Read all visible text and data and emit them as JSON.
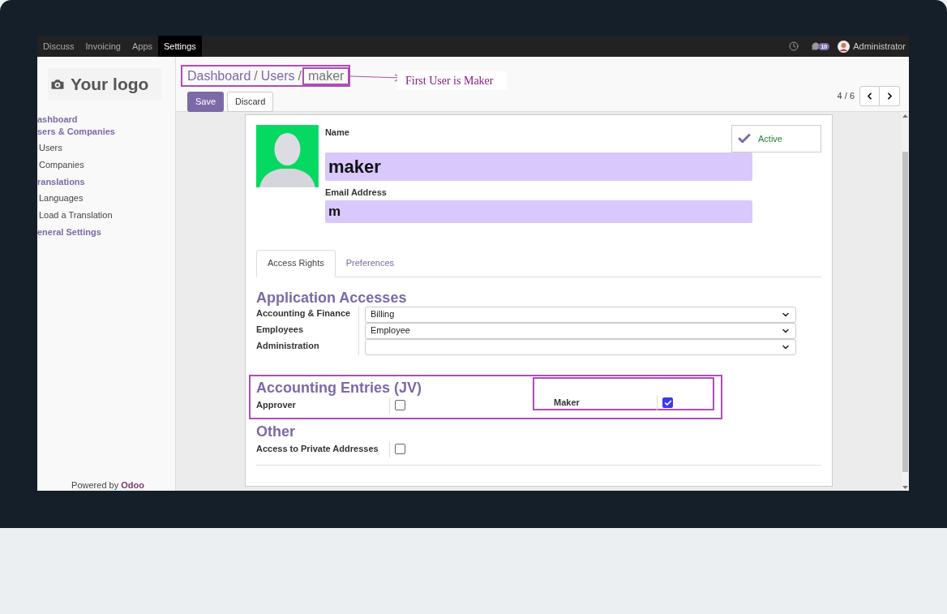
{
  "top_menu": [
    {
      "label": "Discuss",
      "selected": false
    },
    {
      "label": "Invoicing",
      "selected": false
    },
    {
      "label": "Apps",
      "selected": false
    },
    {
      "label": "Settings",
      "selected": true
    }
  ],
  "systray": {
    "messages_count": "10",
    "user": "Administrator"
  },
  "sidebar": {
    "logo_text": "Your logo",
    "items": [
      {
        "label": "ashboard"
      },
      {
        "label": "sers & Companies",
        "children": [
          {
            "label": "Users"
          },
          {
            "label": "Companies"
          }
        ]
      },
      {
        "label": "ranslations",
        "children": [
          {
            "label": "Languages"
          },
          {
            "label": "Load a Translation"
          }
        ]
      },
      {
        "label": "eneral Settings"
      }
    ],
    "footer": {
      "prefix": "Powered by",
      "brand": "Odoo"
    }
  },
  "breadcrumb": {
    "links": [
      {
        "label": "Dashboard",
        "separator": "/"
      },
      {
        "label": "Users",
        "separator": "/"
      }
    ],
    "current": "maker"
  },
  "annotation": "First User is Maker",
  "buttons": {
    "save": "Save",
    "discard": "Discard"
  },
  "pager": "4 / 6",
  "user_form": {
    "name_label": "Name",
    "name": "maker",
    "email_label": "Email Address",
    "email": "m",
    "active": {
      "label": "Active",
      "on": true
    }
  },
  "tabs": [
    {
      "label": "Access Rights",
      "selected": true
    },
    {
      "label": "Preferences",
      "selected": false
    }
  ],
  "sections": [
    {
      "title": "Application Accesses",
      "kind": "selects",
      "highlighted": false,
      "rows": [
        {
          "label": "Accounting & Finance",
          "value": "Billing"
        },
        {
          "label": "Employees",
          "value": "Employee"
        },
        {
          "label": "Administration"
        }
      ]
    },
    {
      "title": "Accounting Entries (JV)",
      "kind": "checks",
      "highlighted": true,
      "rows": [
        {
          "label": "Approver",
          "checked": false,
          "highlighted": false
        },
        {
          "label": "Maker",
          "checked": true,
          "highlighted": true
        }
      ]
    },
    {
      "title": "Other",
      "kind": "checks",
      "highlighted": false,
      "rows": [
        {
          "label": "Access to Private Addresses",
          "checked": false,
          "highlighted": false
        }
      ]
    }
  ]
}
